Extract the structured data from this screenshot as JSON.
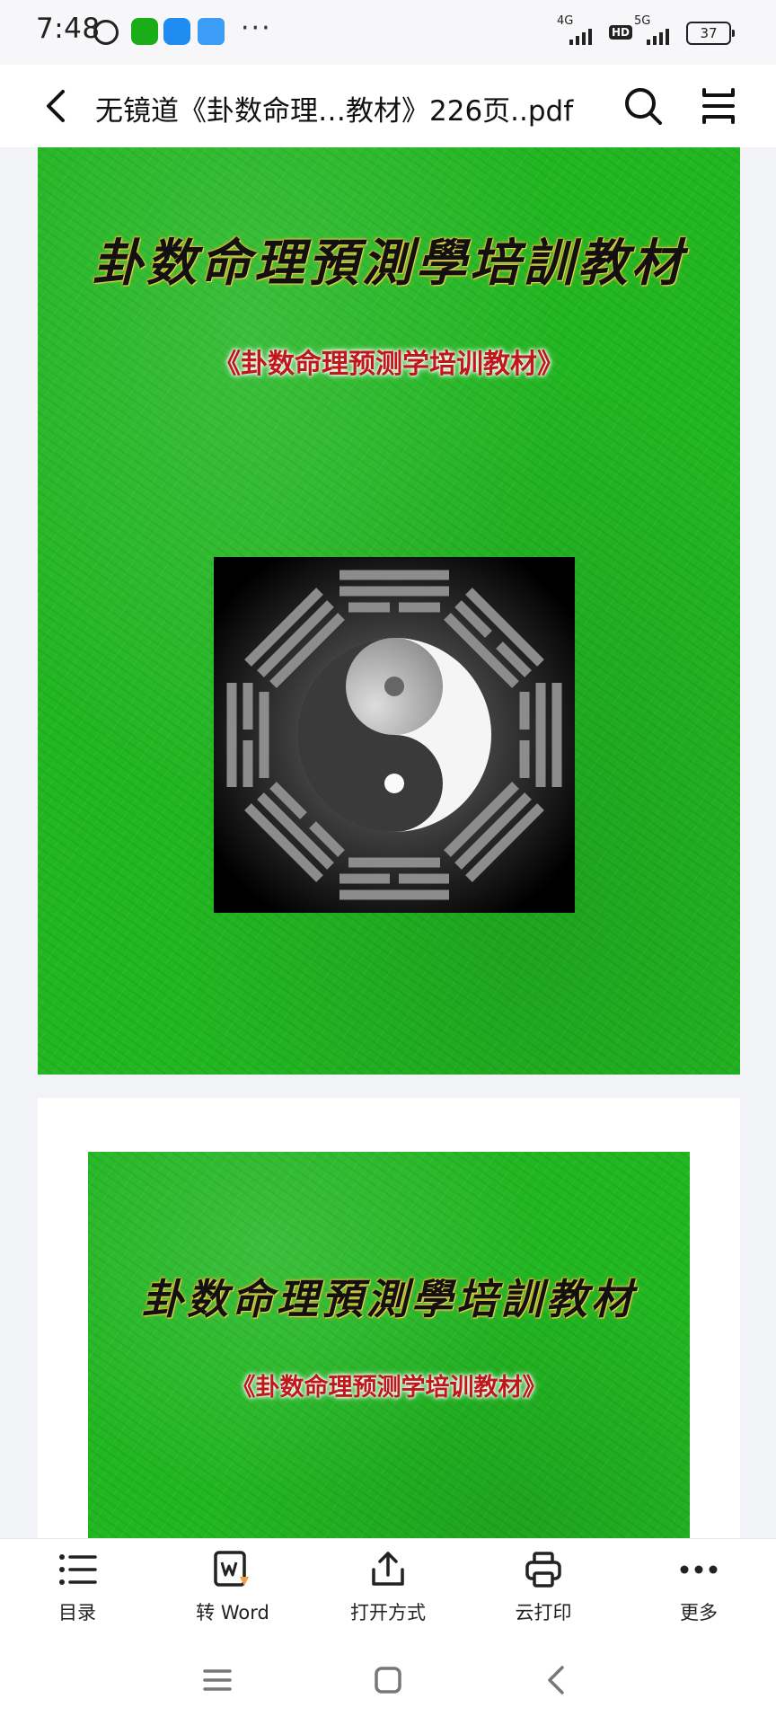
{
  "status_bar": {
    "time": "7:48",
    "notification_icons": [
      "alarm-icon",
      "wechat-icon",
      "app-icon",
      "app-icon"
    ],
    "more_dots": "···",
    "signal_1_label": "4G",
    "hd_label": "HD",
    "signal_2_label": "5G",
    "battery": "37"
  },
  "header": {
    "back_icon": "chevron-left-icon",
    "title": "无镜道《卦数命理…教材》226页..pdf",
    "search_icon": "search-icon",
    "menu_icon": "menu-icon"
  },
  "document": {
    "page1": {
      "calligraphy_title": "卦数命理預測學培訓教材",
      "subtitle": "《卦数命理预测学培训教材》",
      "image": "yin-yang-bagua"
    },
    "page2": {
      "calligraphy_title": "卦数命理預測學培訓教材",
      "subtitle": "《卦数命理预测学培训教材》"
    },
    "colors": {
      "cover_green": "#22b622",
      "subtitle_red": "#c0171b"
    }
  },
  "toolbar": {
    "items": [
      {
        "label": "目录",
        "icon": "list-icon"
      },
      {
        "label": "转 Word",
        "icon": "word-convert-icon"
      },
      {
        "label": "打开方式",
        "icon": "share-icon"
      },
      {
        "label": "云打印",
        "icon": "printer-icon"
      },
      {
        "label": "更多",
        "icon": "more-icon"
      }
    ]
  },
  "system_nav": {
    "icons": [
      "recents-icon",
      "home-icon",
      "back-icon"
    ]
  }
}
